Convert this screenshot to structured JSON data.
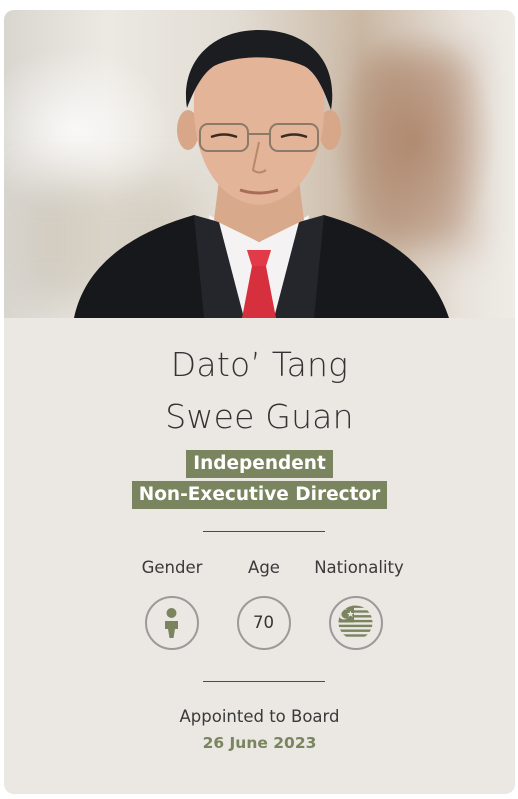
{
  "profile": {
    "name_line1": "Dato’ Tang",
    "name_line2": "Swee Guan",
    "role_line1": "Independent",
    "role_line2": "Non-Executive Director"
  },
  "stats": {
    "gender_label": "Gender",
    "age_label": "Age",
    "nationality_label": "Nationality",
    "age_value": "70",
    "gender_icon": "male-person-icon",
    "nationality_icon": "malaysia-flag-icon"
  },
  "appointment": {
    "label": "Appointed to Board",
    "date": "26 June 2023"
  },
  "colors": {
    "accent": "#7a8560",
    "card_background": "#ebe7e2",
    "text": "#333333",
    "circle_border": "#9a9a9a"
  }
}
